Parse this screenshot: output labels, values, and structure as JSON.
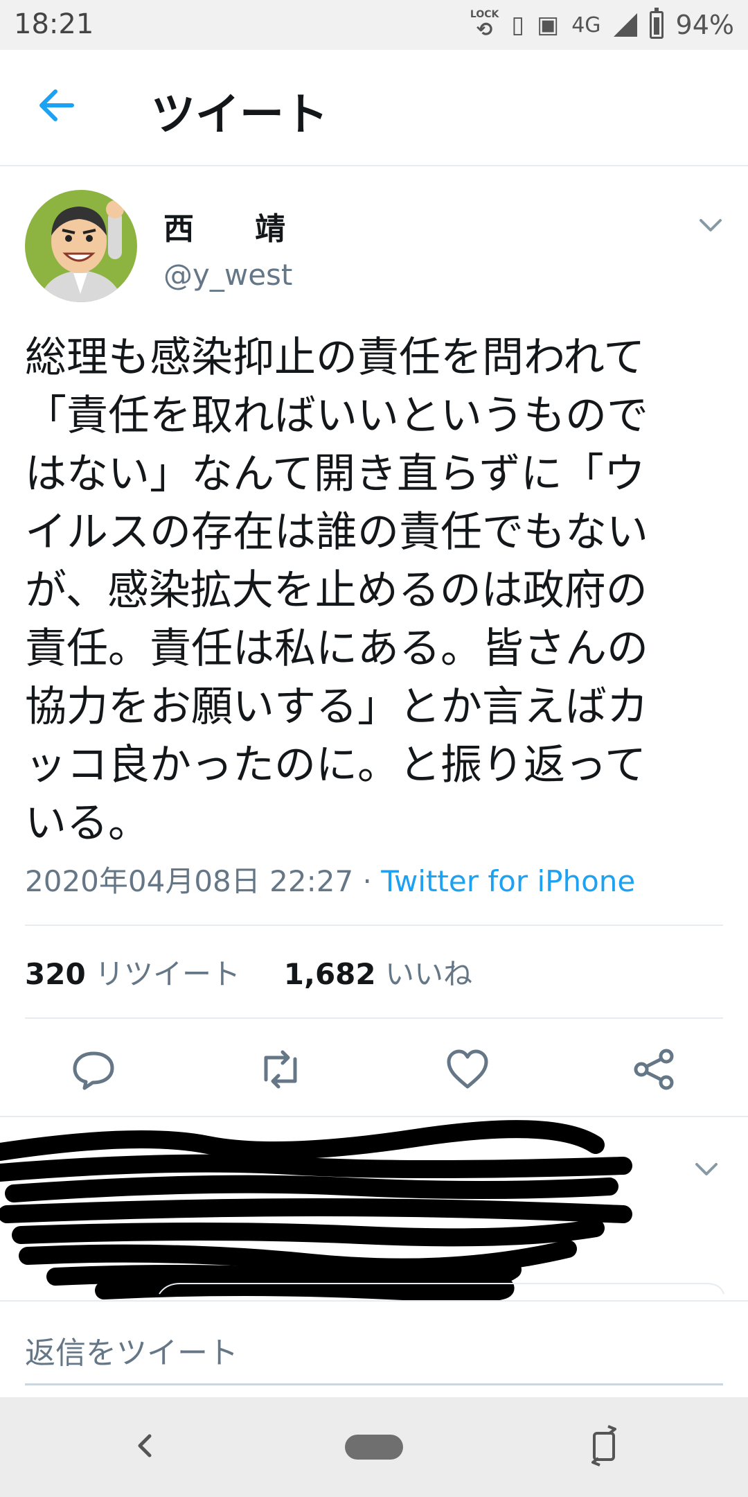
{
  "status_bar": {
    "time": "18:21",
    "lock_label": "LOCK",
    "network": "4G",
    "battery": "94%"
  },
  "header": {
    "title": "ツイート",
    "back_icon": "arrow-left-icon"
  },
  "tweet": {
    "author_name": "西　靖",
    "author_handle": "@y_west",
    "text_lines": [
      "総理も感染抑止の責任を問われて",
      "「責任を取ればいいというもので",
      "はない」なんて開き直らずに「ウ",
      "イルスの存在は誰の責任でもない",
      "が、感染拡大を止めるのは政府の",
      "責任。責任は私にある。皆さんの",
      "協力をお願いする」とか言えばカ",
      "ッコ良かったのに。と振り返って",
      "いる。"
    ],
    "timestamp": "2020年04月08日 22:27",
    "separator": " · ",
    "source": "Twitter for iPhone",
    "retweet_count": "320",
    "retweet_label": "リツイート",
    "like_count": "1,682",
    "like_label": "いいね",
    "accent_color": "#1da1f2"
  },
  "actions": [
    {
      "name": "reply",
      "icon": "reply-icon"
    },
    {
      "name": "retweet",
      "icon": "retweet-icon"
    },
    {
      "name": "like",
      "icon": "heart-icon"
    },
    {
      "name": "share",
      "icon": "share-icon"
    }
  ],
  "reply_box": {
    "placeholder": "返信をツイート"
  }
}
